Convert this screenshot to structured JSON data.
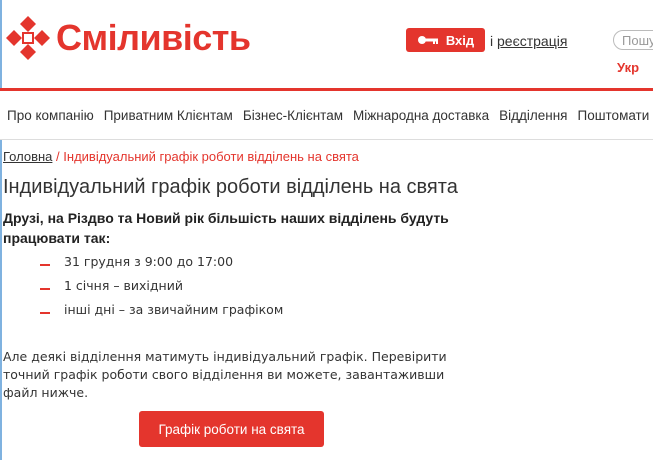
{
  "header": {
    "logo_text": "Сміливість",
    "login_label": "Вхід",
    "register_sep": "і",
    "register_link": "реєстрація",
    "search_placeholder": "Пошук",
    "language": "Укр"
  },
  "nav": {
    "items": [
      {
        "label": "Про компанію"
      },
      {
        "label": "Приватним Клієнтам"
      },
      {
        "label": "Бізнес-Клієнтам"
      },
      {
        "label": "Міжнародна доставка"
      },
      {
        "label": "Відділення"
      },
      {
        "label": "Поштомати"
      }
    ]
  },
  "breadcrumb": {
    "home": "Головна",
    "separator": "/",
    "current": "Індивідуальний графік роботи відділень на свята"
  },
  "page": {
    "title": "Індивідуальний графік роботи відділень на свята",
    "intro": "Друзі, на Різдво та Новий рік більшість наших відділень будуть працювати так:",
    "items": [
      {
        "text": "31 грудня з 9:00 до 17:00"
      },
      {
        "text": "1 січня – вихідний"
      },
      {
        "text": "інші дні – за звичайним графіком"
      }
    ],
    "paragraph": "Але деякі відділення матимуть індивідуальний графік. Перевірити точний графік роботи свого відділення ви можете, завантаживши файл нижче.",
    "download_button": "Графік роботи на свята"
  },
  "colors": {
    "brand_red": "#e4352d"
  }
}
